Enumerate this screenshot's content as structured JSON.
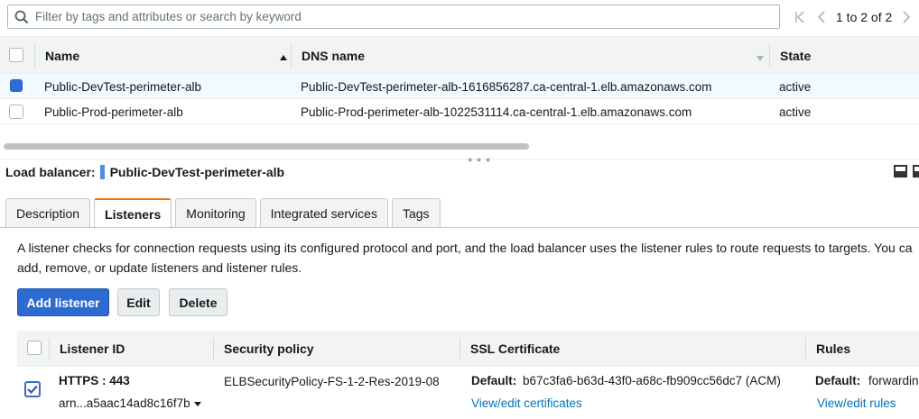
{
  "filter": {
    "placeholder": "Filter by tags and attributes or search by keyword",
    "pager_text": "1 to 2 of 2"
  },
  "grid": {
    "columns": {
      "name": "Name",
      "dns": "DNS name",
      "state": "State"
    },
    "rows": [
      {
        "name": "Public-DevTest-perimeter-alb",
        "dns": "Public-DevTest-perimeter-alb-1616856287.ca-central-1.elb.amazonaws.com",
        "state": "active",
        "selected": true
      },
      {
        "name": "Public-Prod-perimeter-alb",
        "dns": "Public-Prod-perimeter-alb-1022531114.ca-central-1.elb.amazonaws.com",
        "state": "active",
        "selected": false
      }
    ]
  },
  "detail": {
    "label": "Load balancer:",
    "name": "Public-DevTest-perimeter-alb",
    "tabs": [
      "Description",
      "Listeners",
      "Monitoring",
      "Integrated services",
      "Tags"
    ],
    "active_tab": "Listeners",
    "description_line1": "A listener checks for connection requests using its configured protocol and port, and the load balancer uses the listener rules to route requests to targets. You ca",
    "description_line2": "add, remove, or update listeners and listener rules.",
    "buttons": {
      "add": "Add listener",
      "edit": "Edit",
      "delete": "Delete"
    }
  },
  "listeners": {
    "columns": {
      "id": "Listener ID",
      "policy": "Security policy",
      "ssl": "SSL Certificate",
      "rules": "Rules"
    },
    "rows": [
      {
        "protocol_port": "HTTPS : 443",
        "arn": "arn...a5aac14ad8c16f7b",
        "policy": "ELBSecurityPolicy-FS-1-2-Res-2019-08",
        "ssl_label": "Default:",
        "ssl_value": "b67c3fa6-b63d-43f0-a68c-fb909cc56dc7 (ACM)",
        "ssl_link": "View/edit certificates",
        "rules_label": "Default:",
        "rules_value": "forwardin",
        "rules_link": "View/edit rules",
        "checked": true
      }
    ]
  },
  "colors": {
    "primary": "#2e6bd1",
    "link": "#0073bb",
    "active_tab": "#ec7211",
    "selected_row": "#f1faff"
  }
}
